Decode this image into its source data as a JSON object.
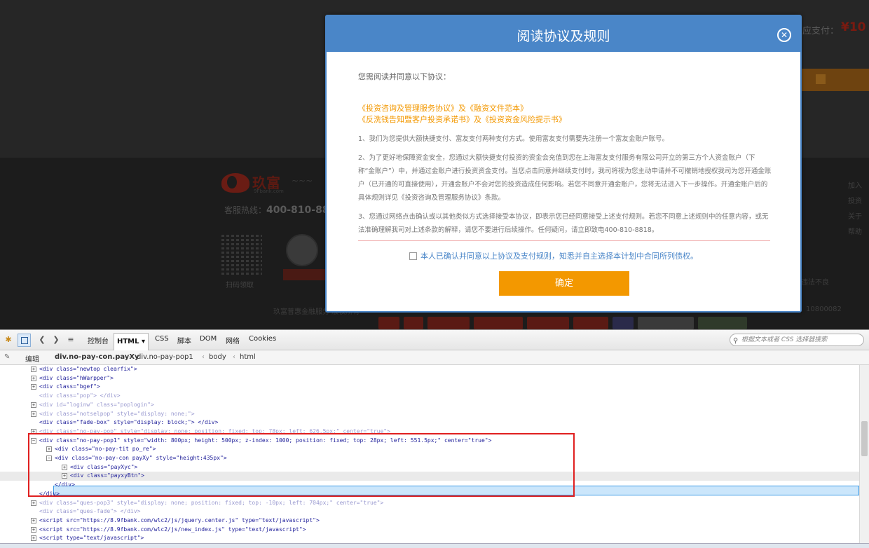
{
  "site": {
    "price_label": "应支付：",
    "price_value": "¥10",
    "logo_name": "玖富",
    "logo_sub": "9Fbank.com",
    "hotline_label": "客服热线：",
    "hotline_number": "400-810-8818",
    "qr_label": "扫码领取",
    "footer_text": "玖富普惠金融服务 版权所有",
    "footer_num": "10800082",
    "footer_link": "违法不良",
    "right_col": [
      "加入",
      "投资",
      "关于",
      "帮助"
    ]
  },
  "modal": {
    "title": "阅读协议及规则",
    "close_glyph": "✕",
    "intro": "您需阅读并同意以下协议：",
    "link_line1": "《投资咨询及管理服务协议》及《融资文件范本》",
    "link_line2": "《反洗钱告知暨客户投资承诺书》及《投资资金风险提示书》",
    "terms": [
      "1、我们为您提供大额快捷支付、富友支付两种支付方式。使用富友支付需要先注册一个富友金账户账号。",
      "2、为了更好地保障资金安全，您通过大额快捷支付投资的资金会充值到您在上海富友支付服务有限公司开立的第三方个人资金账户（下称“金账户”）中，并通过金账户进行投资资金支付。当您点击同意并继续支付时，我司将视为您主动申请并不可撤销地授权我司为您开通金账户（已开通的可直接使用），开通金账户不会对您的投资造成任何影响。若您不同意开通金账户，您将无法进入下一步操作。开通金账户后的具体规则详见《投资咨询及管理服务协议》条款。",
      "3、您通过网络点击确认或以其他类似方式选择接受本协议，即表示您已经同意接受上述支付规则。若您不同意上述规则中的任意内容，或无法准确理解我司对上述条款的解释，请您不要进行后续操作。任何疑问，请立即致电400-810-8818。"
    ],
    "agree_text": "本人已确认并同意以上协议及支付规则，知悉并自主选择本计划中合同所列债权。",
    "confirm_label": "确定"
  },
  "devtools": {
    "tabs": [
      "控制台",
      "HTML ▾",
      "CSS",
      "脚本",
      "DOM",
      "网络",
      "Cookies"
    ],
    "search_placeholder": "根据文本或者 CSS 选择器搜索",
    "edit_label": "编辑",
    "breadcrumb": [
      "div.no-pay-con.payXy",
      "div.no-pay-pop1",
      "body",
      "html"
    ],
    "tree_rows": [
      {
        "toggle": "+",
        "indent": 0,
        "text": "<div class=\"newtop clearfix\">",
        "dim": false
      },
      {
        "toggle": "+",
        "indent": 0,
        "text": "<div class=\"hWarpper\">",
        "dim": false
      },
      {
        "toggle": "+",
        "indent": 0,
        "text": "<div class=\"bgef\">",
        "dim": false
      },
      {
        "toggle": "",
        "indent": 0,
        "text": "<div class=\"pop\"> </div>",
        "dim": true
      },
      {
        "toggle": "+",
        "indent": 0,
        "text": "<div id=\"loginw\" class=\"poplogin\">",
        "dim": true
      },
      {
        "toggle": "+",
        "indent": 0,
        "text": "<div class=\"notselpop\" style=\"display: none;\">",
        "dim": true
      },
      {
        "toggle": "",
        "indent": 0,
        "text": "<div class=\"fade-box\" style=\"display: block;\"> </div>",
        "dim": false
      },
      {
        "toggle": "+",
        "indent": 0,
        "text": "<div class=\"no-pay-pop\" style=\"display: none; position: fixed; top: 78px; left: 626.5px;\" center=\"true\">",
        "dim": true
      },
      {
        "toggle": "−",
        "indent": 0,
        "text": "<div class=\"no-pay-pop1\" style=\"width: 800px; height: 500px; z-index: 1000; position: fixed; top: 28px; left: 551.5px;\" center=\"true\">",
        "dim": false
      },
      {
        "toggle": "+",
        "indent": 1,
        "text": "<div class=\"no-pay-tit po_re\">",
        "dim": false
      },
      {
        "toggle": "−",
        "indent": 1,
        "text": "<div class=\"no-pay-con payXy\" style=\"height:435px\">",
        "dim": false
      },
      {
        "toggle": "+",
        "indent": 2,
        "text": "<div class=\"payXyc\">",
        "dim": false
      },
      {
        "toggle": "+",
        "indent": 2,
        "text": "<div class=\"payxyBtn\">",
        "dim": false
      },
      {
        "toggle": "",
        "indent": 1,
        "text": "</div>",
        "dim": false
      },
      {
        "toggle": "",
        "indent": 0,
        "text": "</div>",
        "dim": false
      },
      {
        "toggle": "+",
        "indent": 0,
        "text": "<div class=\"ques-pop3\" style=\"display: none; position: fixed; top: -10px; left: 704px;\" center=\"true\">",
        "dim": true
      },
      {
        "toggle": "",
        "indent": 0,
        "text": "<div class=\"ques-fade\"> </div>",
        "dim": true
      },
      {
        "toggle": "+",
        "indent": 0,
        "text": "<script src=\"https://8.9fbank.com/wlc2/js/jquery.center.js\" type=\"text/javascript\">",
        "dim": false
      },
      {
        "toggle": "+",
        "indent": 0,
        "text": "<script src=\"https://8.9fbank.com/wlc2/js/new_index.js\" type=\"text/javascript\">",
        "dim": false
      },
      {
        "toggle": "+",
        "indent": 0,
        "text": "<script type=\"text/javascript\">",
        "dim": false
      },
      {
        "toggle": "+",
        "indent": 0,
        "text": "<script type=\"text/javascript\">",
        "dim": false
      }
    ]
  },
  "colors": {
    "modal_header": "#4a86c8",
    "link_orange": "#f39800",
    "confirm_button": "#f39800",
    "highlight_box": "#e02020",
    "selection": "#3399ff"
  }
}
